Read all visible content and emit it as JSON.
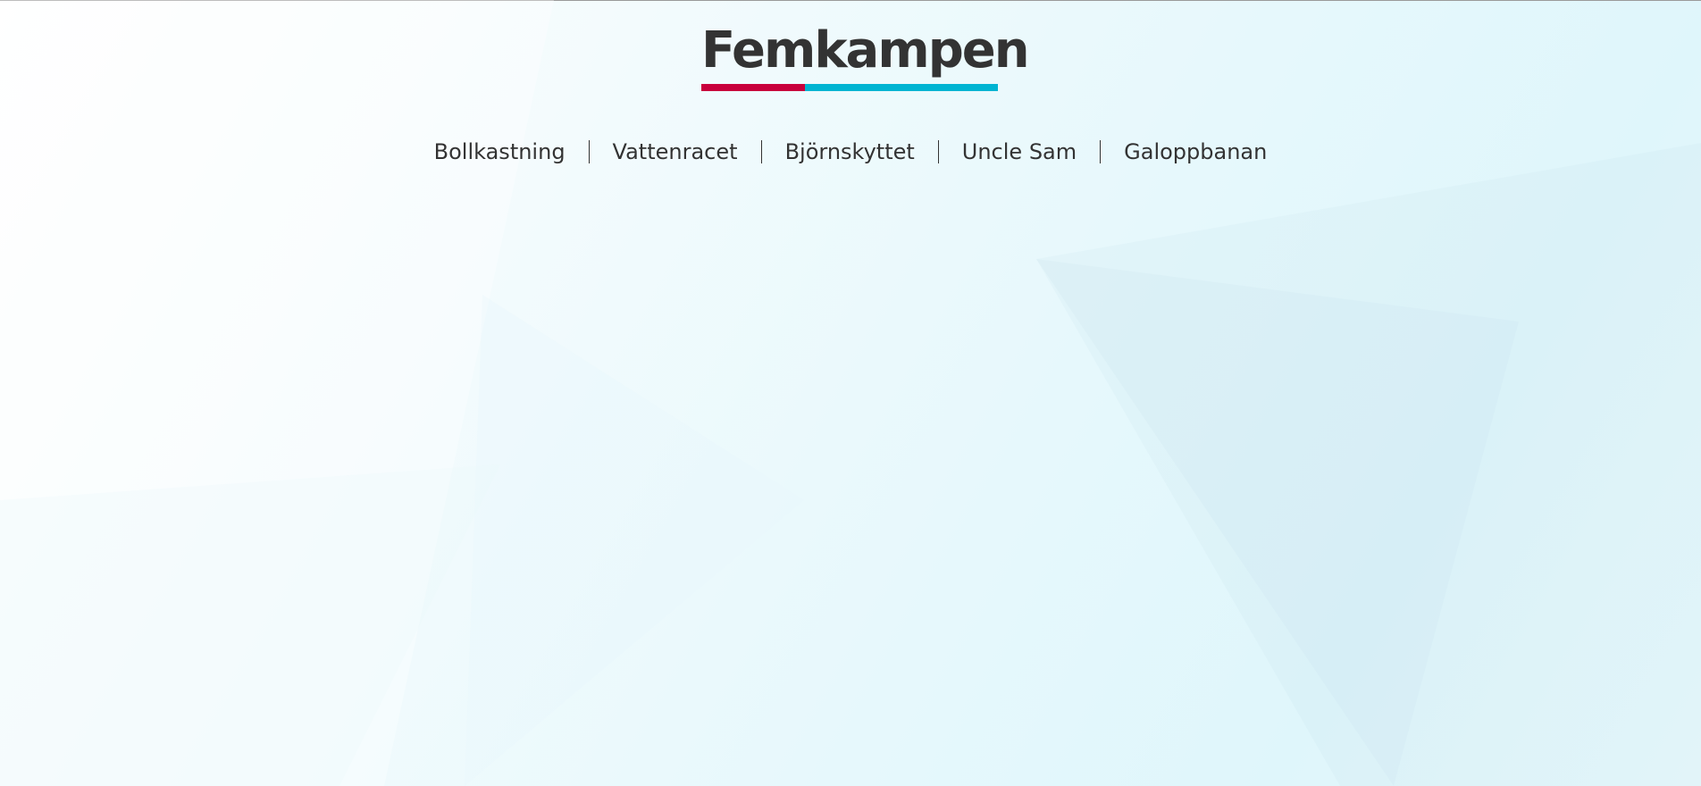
{
  "header": {
    "title": "Femkampen",
    "underline_colors": [
      "#c8003c",
      "#00b4d2"
    ]
  },
  "nav": {
    "items": [
      {
        "label": "Bollkastning"
      },
      {
        "label": "Vattenracet"
      },
      {
        "label": "Björnskyttet"
      },
      {
        "label": "Uncle Sam"
      },
      {
        "label": "Galoppbanan"
      }
    ]
  },
  "colors": {
    "text": "#333333",
    "background_tint": "#dff6fb"
  }
}
